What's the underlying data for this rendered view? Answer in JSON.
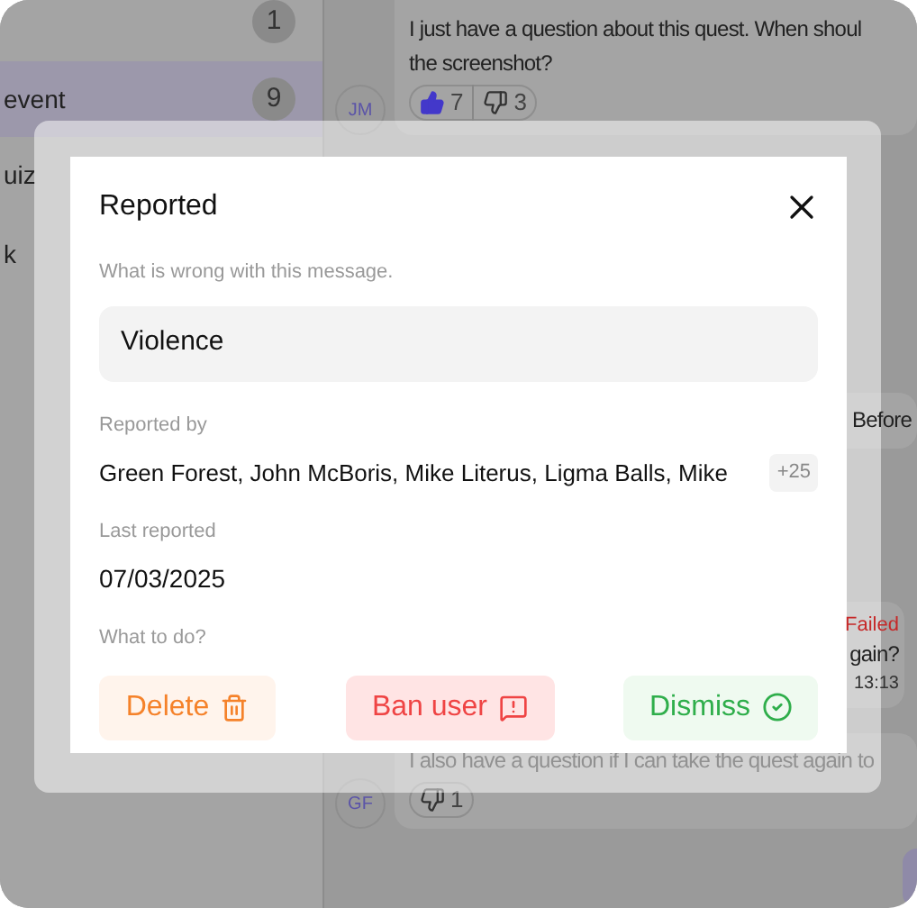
{
  "sidebar": {
    "items": [
      {
        "badge": "1",
        "selected": false
      },
      {
        "label": "event",
        "badge": "9",
        "selected": true
      },
      {
        "label": "uiz",
        "selected": false
      },
      {
        "label": "k",
        "selected": false
      }
    ]
  },
  "messages": [
    {
      "avatar": "JM",
      "lines": [
        "I just have a question about this quest. When shoul",
        "the screenshot?"
      ],
      "reactions": [
        {
          "kind": "like",
          "count": "7",
          "active": true
        },
        {
          "kind": "dislike",
          "count": "3",
          "active": false
        }
      ]
    },
    {
      "lines": [
        "Before"
      ]
    },
    {
      "status": "Failed",
      "lines": [
        "gain?"
      ],
      "time": "13:13"
    },
    {
      "avatar": "GF",
      "lines": [
        "I also have a question if I can take the quest again to"
      ],
      "reactions": [
        {
          "kind": "dislike",
          "count": "1",
          "active": false
        }
      ]
    }
  ],
  "dialog": {
    "title": "Reported",
    "reason_label": "What is wrong with this message.",
    "reason_value": "Violence",
    "reported_by_label": "Reported by",
    "reported_by": "Green Forest, John McBoris, Mike Literus, Ligma Balls, Mike",
    "more_count": "+25",
    "last_reported_label": "Last reported",
    "last_reported": "07/03/2025",
    "action_label": "What to do?",
    "actions": [
      {
        "kind": "delete",
        "label": "Delete"
      },
      {
        "kind": "ban",
        "label": "Ban user"
      },
      {
        "kind": "dismiss",
        "label": "Dismiss"
      }
    ]
  }
}
